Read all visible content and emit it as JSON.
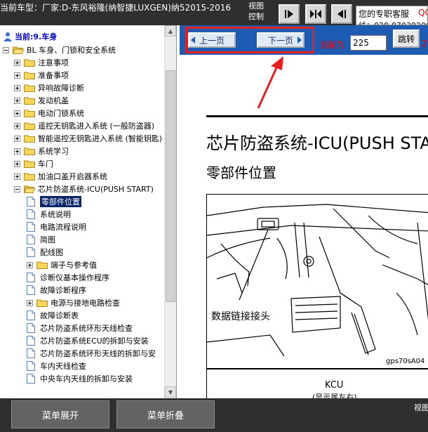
{
  "topbar": {
    "car_title": "当前车型：厂家:D-东风裕隆(纳智捷LUXGEN)纳52015-2016",
    "view_control": "视图控制",
    "support_label": "您的专职客服",
    "support_qq": "QQ",
    "support_phone": "线：028-87038200"
  },
  "tree": {
    "root": "当前:9.车身",
    "items": [
      {
        "label": "BL 车身、门锁和安全系统",
        "level": 0,
        "type": "folder",
        "expanded": true
      },
      {
        "label": "注意事项",
        "level": 1,
        "type": "folder",
        "expanded": false
      },
      {
        "label": "准备事项",
        "level": 1,
        "type": "folder",
        "expanded": false
      },
      {
        "label": "异响故障诊断",
        "level": 1,
        "type": "folder",
        "expanded": false
      },
      {
        "label": "发动机盖",
        "level": 1,
        "type": "folder",
        "expanded": false
      },
      {
        "label": "电动门锁系统",
        "level": 1,
        "type": "folder",
        "expanded": false
      },
      {
        "label": "遥控无钥匙进入系统 (一般防盗器)",
        "level": 1,
        "type": "folder",
        "expanded": false
      },
      {
        "label": "智能遥控无钥匙进入系统 (智能钥匙)",
        "level": 1,
        "type": "folder",
        "expanded": false
      },
      {
        "label": "系统学习",
        "level": 1,
        "type": "folder",
        "expanded": false
      },
      {
        "label": "车门",
        "level": 1,
        "type": "folder",
        "expanded": false
      },
      {
        "label": "加油口盖开启器系统",
        "level": 1,
        "type": "folder",
        "expanded": false
      },
      {
        "label": "芯片防盗系统-ICU(PUSH START)",
        "level": 1,
        "type": "folder",
        "expanded": true
      },
      {
        "label": "零部件位置",
        "level": 2,
        "type": "doc",
        "selected": true
      },
      {
        "label": "系统说明",
        "level": 2,
        "type": "doc"
      },
      {
        "label": "电路流程说明",
        "level": 2,
        "type": "doc"
      },
      {
        "label": "简图",
        "level": 2,
        "type": "doc"
      },
      {
        "label": "配线图",
        "level": 2,
        "type": "doc"
      },
      {
        "label": "端子与参考值",
        "level": 2,
        "type": "folder",
        "expanded": false
      },
      {
        "label": "诊断仪基本操作程序",
        "level": 2,
        "type": "doc"
      },
      {
        "label": "故障诊断程序",
        "level": 2,
        "type": "doc"
      },
      {
        "label": "电源与接地电路检查",
        "level": 2,
        "type": "folder",
        "expanded": false
      },
      {
        "label": "故障诊断表",
        "level": 2,
        "type": "doc"
      },
      {
        "label": "芯片防盗系统环形天线检查",
        "level": 2,
        "type": "doc"
      },
      {
        "label": "芯片防盗系统ECU的拆卸与安装",
        "level": 2,
        "type": "doc"
      },
      {
        "label": "芯片防盗系统环形天线的拆卸与安",
        "level": 2,
        "type": "doc"
      },
      {
        "label": "车内天线检查",
        "level": 2,
        "type": "doc"
      },
      {
        "label": "中央车内天线的拆卸与安装",
        "level": 2,
        "type": "doc"
      }
    ]
  },
  "nav": {
    "prev_label": "上一页",
    "next_label": "下一页",
    "current_label": "当前为",
    "page_value": "225",
    "jump_label": "跳转",
    "total_pages": "2"
  },
  "doc": {
    "heading": "芯片防盗系统-ICU(PUSH START)",
    "subheading": "零部件位置",
    "figure_label": "数据链接接头",
    "figure_code": "gps70sA04",
    "kcu_label": "KCU",
    "kcu_sub": "(显示属左右)"
  },
  "bottom": {
    "expand_label": "菜单展开",
    "collapse_label": "菜单折叠",
    "view_control": "视图控制"
  },
  "colors": {
    "dark_bar": "#2f2f2f",
    "nav_blue": "#1e5bb3",
    "highlight_red": "#e61e1e",
    "selected_bg": "#0a246a"
  }
}
